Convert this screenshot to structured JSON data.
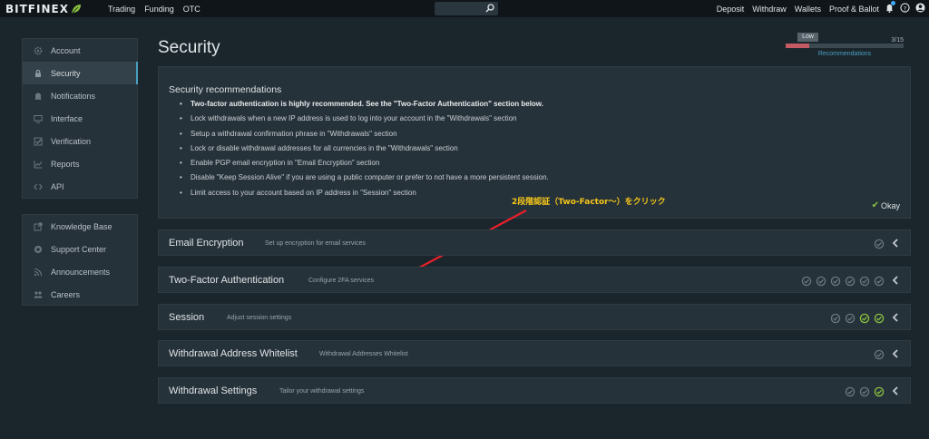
{
  "header": {
    "logo": "BITFINEX",
    "nav_left": [
      "Trading",
      "Funding",
      "OTC"
    ],
    "nav_right": [
      "Deposit",
      "Withdraw",
      "Wallets",
      "Proof & Ballot"
    ]
  },
  "sidebar": {
    "group1": [
      {
        "label": "Account",
        "icon": "gear-icon"
      },
      {
        "label": "Security",
        "icon": "lock-icon"
      },
      {
        "label": "Notifications",
        "icon": "bell-icon"
      },
      {
        "label": "Interface",
        "icon": "monitor-icon"
      },
      {
        "label": "Verification",
        "icon": "check-icon"
      },
      {
        "label": "Reports",
        "icon": "chart-icon"
      },
      {
        "label": "API",
        "icon": "code-icon"
      }
    ],
    "group2": [
      {
        "label": "Knowledge Base",
        "icon": "external-link-icon"
      },
      {
        "label": "Support Center",
        "icon": "lifebuoy-icon"
      },
      {
        "label": "Announcements",
        "icon": "rss-icon"
      },
      {
        "label": "Careers",
        "icon": "people-icon"
      }
    ]
  },
  "main": {
    "title": "Security",
    "progress": {
      "badge": "Low",
      "count": "3/15",
      "fraction": 0.2,
      "link": "Recommendations",
      "color": "#c35a64"
    },
    "recommendations": {
      "title": "Security recommendations",
      "items": [
        "Two-factor authentication is highly recommended. See the \"Two-Factor Authentication\" section below.",
        "Lock withdrawals when a new IP address is used to log into your account in the \"Withdrawals\" section",
        "Setup a withdrawal confirmation phrase in \"Withdrawals\" section",
        "Lock or disable withdrawal addresses for all currencies in the \"Withdrawals\" section",
        "Enable PGP email encryption in \"Email Encryption\" section",
        "Disable \"Keep Session Alive\" if you are using a public computer or prefer to not have a more persistent session.",
        "Limit access to your account based on IP address in \"Session\" section"
      ],
      "okay": "Okay"
    },
    "annotation": "2段階認証（Two-Factor～）をクリック",
    "sections": [
      {
        "title": "Email Encryption",
        "desc": "Set up encryption for email services",
        "statuses": [
          "off"
        ]
      },
      {
        "title": "Two-Factor Authentication",
        "desc": "Configure 2FA services",
        "statuses": [
          "off",
          "off",
          "off",
          "off",
          "off",
          "off"
        ]
      },
      {
        "title": "Session",
        "desc": "Adjust session settings",
        "statuses": [
          "off",
          "off",
          "on",
          "on"
        ]
      },
      {
        "title": "Withdrawal Address Whitelist",
        "desc": "Withdrawal Addresses Whitelist",
        "statuses": [
          "off"
        ]
      },
      {
        "title": "Withdrawal Settings",
        "desc": "Tailor your withdrawal settings",
        "statuses": [
          "off",
          "off",
          "on"
        ]
      }
    ]
  },
  "colors": {
    "accent": "#4a9fc2",
    "on": "#8ac140",
    "annotation": "#f5c518",
    "arrow": "#e8202a"
  }
}
